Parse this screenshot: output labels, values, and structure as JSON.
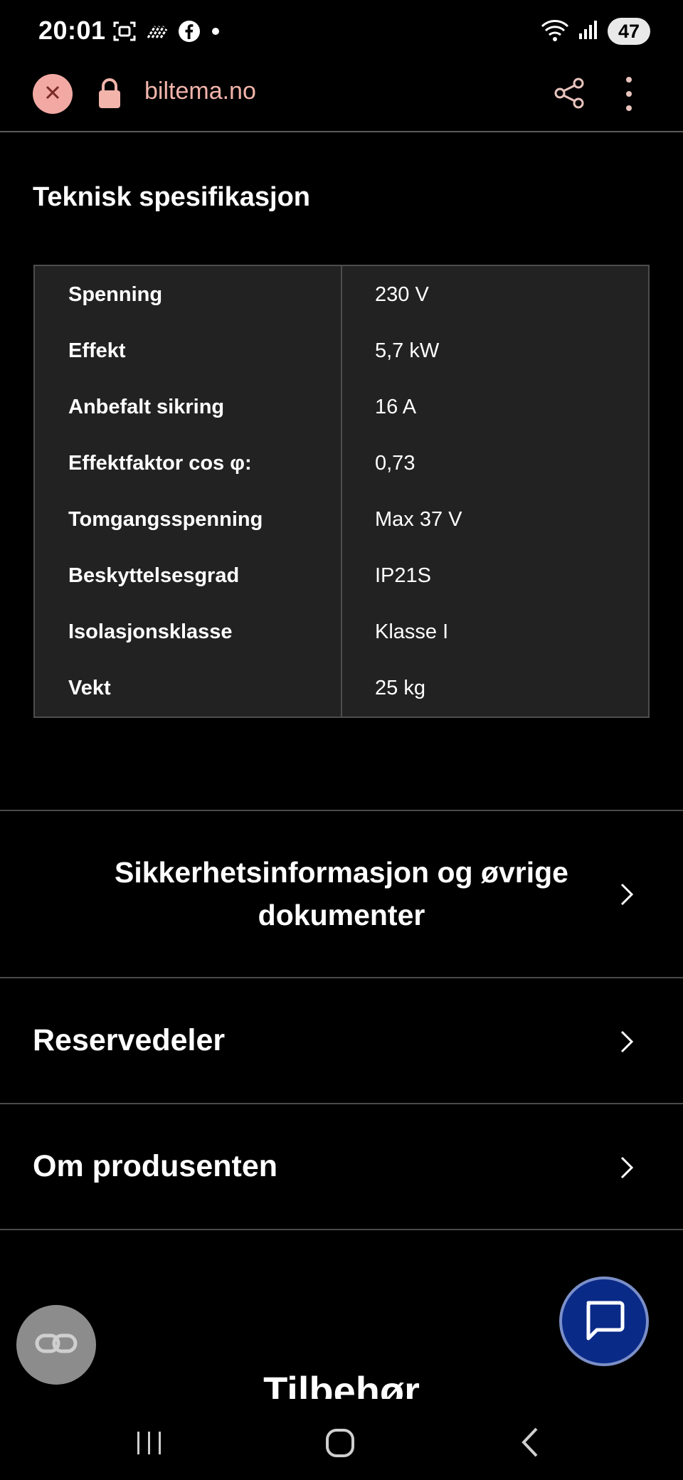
{
  "status_bar": {
    "time": "20:01",
    "battery": "47",
    "icons_left": [
      "screenshot-icon",
      "nfc-tap-icon",
      "facebook-icon",
      "dot-icon"
    ],
    "icons_right": [
      "wifi-icon",
      "signal-icon",
      "battery-icon"
    ]
  },
  "browser": {
    "url": "biltema.no",
    "close_icon": "close-icon",
    "lock_icon": "lock-icon",
    "share_icon": "share-icon",
    "menu_icon": "more-vert-icon"
  },
  "specs": {
    "title": "Teknisk spesifikasjon",
    "rows": [
      {
        "key": "Spenning",
        "value": "230 V"
      },
      {
        "key": "Effekt",
        "value": "5,7 kW"
      },
      {
        "key": "Anbefalt sikring",
        "value": "16 A"
      },
      {
        "key": "Effektfaktor cos φ:",
        "value": "0,73"
      },
      {
        "key": "Tomgangsspenning",
        "value": "Max 37 V"
      },
      {
        "key": "Beskyttelsesgrad",
        "value": "IP21S"
      },
      {
        "key": "Isolasjonsklasse",
        "value": "Klasse I"
      },
      {
        "key": "Vekt",
        "value": "25 kg"
      }
    ]
  },
  "accordions": {
    "safety_line1": "Sikkerhetsinformasjon og øvrige",
    "safety_line2": "dokumenter",
    "spare_parts": "Reservedeler",
    "manufacturer": "Om produsenten"
  },
  "next_section_title": "Tilbehør",
  "colors": {
    "background": "#000000",
    "table_bg": "#222222",
    "accent_url": "#f2b4ab",
    "close_button": "#f2a9a3",
    "chat_fab": "#0a2a88"
  },
  "nav_bar": {
    "icons": [
      "recent-apps-icon",
      "home-icon",
      "back-icon"
    ]
  }
}
